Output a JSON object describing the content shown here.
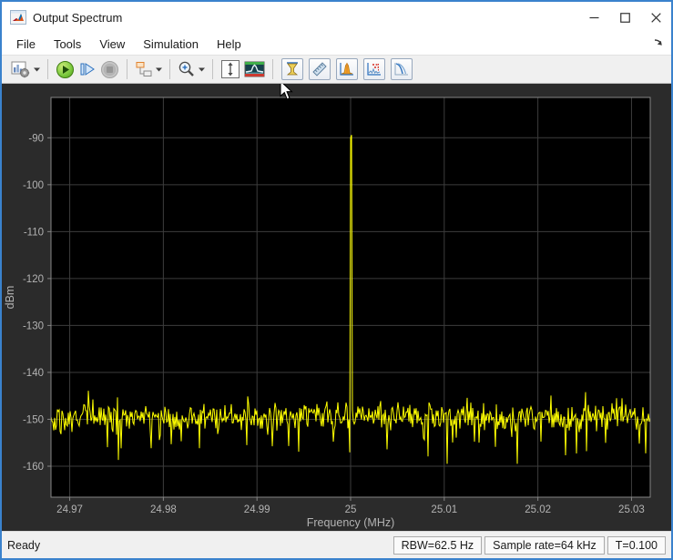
{
  "window": {
    "title": "Output Spectrum"
  },
  "menu": {
    "items": [
      {
        "label": "File"
      },
      {
        "label": "Tools"
      },
      {
        "label": "View"
      },
      {
        "label": "Simulation"
      },
      {
        "label": "Help"
      }
    ]
  },
  "toolbar": {
    "icons": [
      "spectrum-settings-icon",
      "run-icon",
      "step-forward-icon",
      "stop-icon",
      "simulation-step-options-icon",
      "zoom-in-icon",
      "fit-to-view-icon",
      "spectrogram-view-icon",
      "cursor-measurements-icon",
      "signal-statistics-icon",
      "distortion-measurements-icon",
      "peak-finder-icon",
      "ccdf-measurements-icon"
    ]
  },
  "statusbar": {
    "status": "Ready",
    "rbw": "RBW=62.5 Hz",
    "sample_rate": "Sample rate=64 kHz",
    "time": "T=0.100"
  },
  "chart_data": {
    "type": "line",
    "title": "",
    "xlabel": "Frequency (MHz)",
    "ylabel": "dBm",
    "xlim": [
      24.968,
      25.032
    ],
    "ylim": [
      -166.6,
      -81.4
    ],
    "xticks": [
      24.97,
      24.98,
      24.99,
      25,
      25.01,
      25.02,
      25.03
    ],
    "xtick_labels": [
      "24.97",
      "24.98",
      "24.99",
      "25",
      "25.01",
      "25.02",
      "25.03"
    ],
    "yticks": [
      -90,
      -100,
      -110,
      -120,
      -130,
      -140,
      -150,
      -160
    ],
    "grid": true,
    "legend": "none",
    "colors": {
      "plot_bg": "#000000",
      "figure_bg": "#2b2b2b",
      "grid": "#3d3d3d",
      "axis_border": "#858585",
      "tick_label": "#b3b3b3",
      "axis_label": "#b3b3b3",
      "signal": "#ffff00"
    },
    "series": [
      {
        "name": "output-spectrum",
        "peak": {
          "x_mhz": 25.0,
          "y_dbm": -90
        },
        "noise_floor_mean_dbm": -149.5,
        "noise_floor_spread_dbm": 5.0,
        "noise_min_dbm": -159.5,
        "noise_max_dbm": -143.2,
        "n_points": 659,
        "seed": 987654321
      }
    ]
  }
}
